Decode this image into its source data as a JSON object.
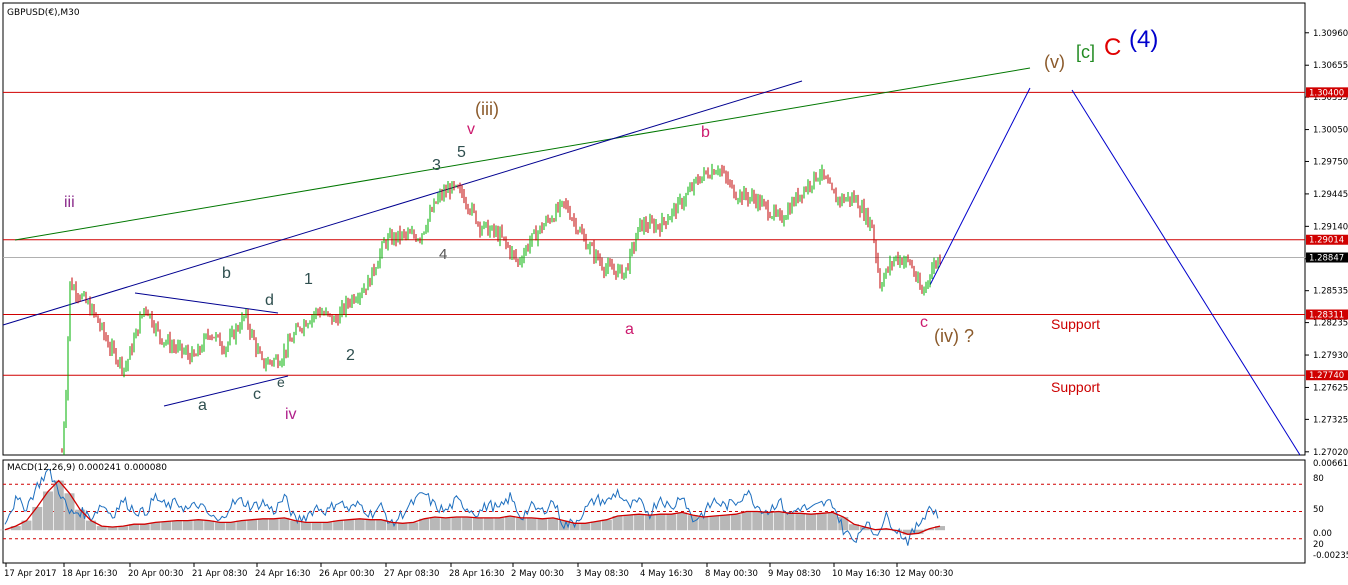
{
  "window": {
    "title": "GBPUSD(€),M30",
    "indicator_title": "MACD(12,26,9) 0.000241 0.000080"
  },
  "colors": {
    "background": "#ffffff",
    "frame": "#000000",
    "candle_up": "#00b000",
    "candle_down": "#c00000",
    "horizontal_lines": "#d00000",
    "green_trendline": "#007700",
    "blue_trendline": "#000090",
    "projection": "#0000cc",
    "current_price_line": "#b0b0b0",
    "macd_main": "#1e6fbf",
    "macd_signal": "#d00000",
    "macd_hist": "#b8b8b8",
    "macd_levels": "#d00000"
  },
  "chart_data": [
    {
      "type": "candlestick",
      "name": "GBPUSD M30",
      "x_labels": [
        "17 Apr 2017",
        "18 Apr 16:30",
        "20 Apr 00:30",
        "21 Apr 08:30",
        "24 Apr 16:30",
        "26 Apr 00:30",
        "27 Apr 08:30",
        "28 Apr 16:30",
        "2 May 00:30",
        "3 May 08:30",
        "4 May 16:30",
        "8 May 00:30",
        "9 May 08:30",
        "10 May 16:30",
        "12 May 00:30"
      ],
      "y_ticks": [
        "1.30960",
        "1.30655",
        "1.30355",
        "1.30050",
        "1.29750",
        "1.29445",
        "1.29140",
        "1.28835",
        "1.28535",
        "1.28235",
        "1.27930",
        "1.27625",
        "1.27325",
        "1.27020"
      ],
      "ylim": [
        1.2699,
        1.3124
      ],
      "path": [
        [
          "17 Apr 2017",
          1.2702
        ],
        [
          "18 Apr 16:30",
          1.286
        ],
        [
          "20 Apr 00:30",
          1.278
        ],
        [
          "21 Apr 08:30",
          1.279
        ],
        [
          "24 Apr 16:30",
          1.2785
        ],
        [
          "26 Apr 00:30",
          1.284
        ],
        [
          "27 Apr 08:30",
          1.2905
        ],
        [
          "28 Apr 16:30",
          1.2955
        ],
        [
          "2 May 00:30",
          1.289
        ],
        [
          "3 May 08:30",
          1.287
        ],
        [
          "4 May 16:30",
          1.291
        ],
        [
          "8 May 00:30",
          1.298
        ],
        [
          "9 May 08:30",
          1.295
        ],
        [
          "10 May 16:30",
          1.294
        ],
        [
          "12 May 00:30",
          1.2875
        ]
      ],
      "price_levels": [
        {
          "value": 1.304,
          "label": "1.30400"
        },
        {
          "value": 1.29014,
          "label": "1.29014"
        },
        {
          "value": 1.28311,
          "label": "1.28311"
        },
        {
          "value": 1.2774,
          "label": "1.27740"
        }
      ],
      "current_price": {
        "value": 1.28847,
        "label": "1.28847"
      },
      "annotations": {
        "wave_labels": [
          "iii",
          "b",
          "1",
          "2",
          "d",
          "a",
          "c",
          "e",
          "iv",
          "3",
          "5",
          "4",
          "v",
          "(iii)",
          "a",
          "b",
          "c",
          "(iv) ?",
          "(v)",
          "[c]",
          "C",
          "(4)"
        ],
        "support_labels": [
          "Support",
          "Support"
        ]
      }
    },
    {
      "type": "line",
      "name": "MACD(12,26,9)",
      "y_ticks": [
        "0.006613",
        "80",
        "50",
        "0.00",
        "20",
        "-0.002354"
      ],
      "series": [
        {
          "name": "MACD",
          "values": [
            0.4,
            0.62,
            0.55,
            0.78,
            0.95,
            0.74,
            0.48,
            0.5,
            0.44,
            0.58,
            0.46,
            0.62,
            0.52,
            0.48,
            0.66,
            0.55,
            0.6,
            0.52,
            0.58,
            0.46,
            0.38,
            0.58,
            0.62,
            0.55,
            0.6,
            0.5,
            0.66,
            0.4,
            0.45,
            0.55,
            0.5,
            0.62,
            0.52,
            0.58,
            0.47,
            0.55,
            0.35,
            0.48,
            0.6,
            0.7,
            0.56,
            0.5,
            0.62,
            0.54,
            0.48,
            0.58,
            0.52,
            0.66,
            0.44,
            0.55,
            0.5,
            0.62,
            0.35,
            0.38,
            0.52,
            0.64,
            0.6,
            0.72,
            0.55,
            0.6,
            0.48,
            0.66,
            0.52,
            0.7,
            0.4,
            0.48,
            0.62,
            0.56,
            0.6,
            0.72,
            0.56,
            0.5,
            0.62,
            0.46,
            0.55,
            0.52,
            0.58,
            0.6,
            0.3,
            0.18,
            0.38,
            0.25,
            0.44,
            0.3,
            0.18,
            0.36,
            0.55,
            0.45
          ]
        },
        {
          "name": "Signal",
          "values": [
            0.3,
            0.34,
            0.4,
            0.55,
            0.72,
            0.84,
            0.7,
            0.52,
            0.4,
            0.34,
            0.33,
            0.34,
            0.36,
            0.36,
            0.38,
            0.39,
            0.4,
            0.4,
            0.41,
            0.4,
            0.38,
            0.38,
            0.4,
            0.41,
            0.42,
            0.42,
            0.43,
            0.4,
            0.38,
            0.38,
            0.38,
            0.4,
            0.41,
            0.42,
            0.41,
            0.41,
            0.38,
            0.37,
            0.38,
            0.42,
            0.44,
            0.43,
            0.44,
            0.44,
            0.43,
            0.43,
            0.43,
            0.45,
            0.43,
            0.43,
            0.42,
            0.43,
            0.4,
            0.37,
            0.37,
            0.39,
            0.41,
            0.45,
            0.46,
            0.47,
            0.46,
            0.47,
            0.47,
            0.49,
            0.46,
            0.44,
            0.45,
            0.46,
            0.47,
            0.5,
            0.5,
            0.49,
            0.5,
            0.48,
            0.48,
            0.47,
            0.48,
            0.49,
            0.44,
            0.36,
            0.33,
            0.3,
            0.31,
            0.29,
            0.25,
            0.26,
            0.31,
            0.34
          ]
        }
      ],
      "levels": [
        80,
        50,
        20
      ]
    }
  ]
}
